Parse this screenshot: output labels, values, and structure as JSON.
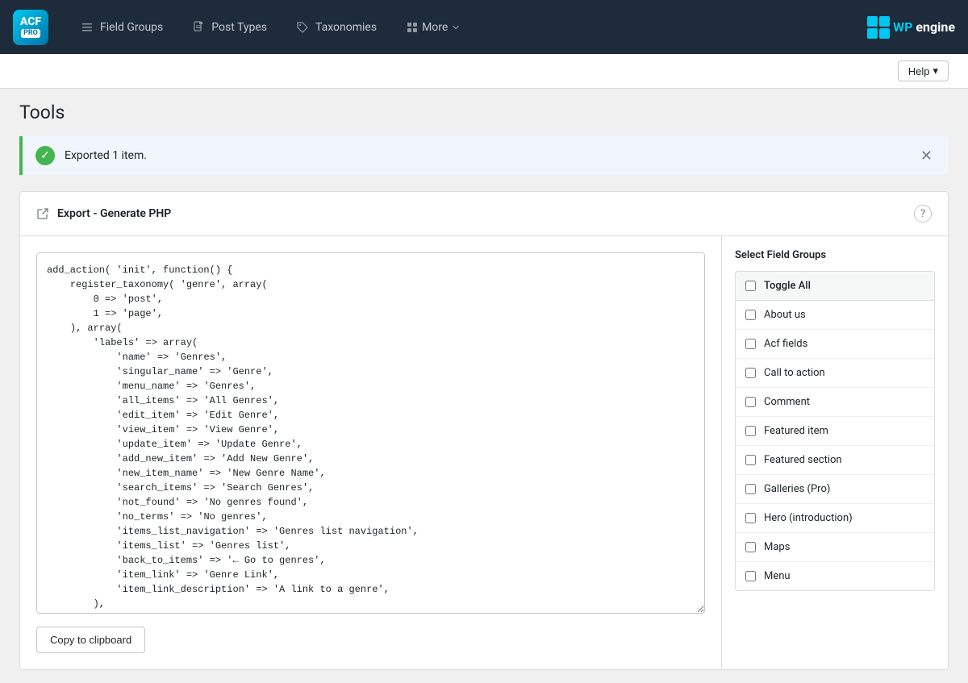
{
  "nav": {
    "logo_acf": "ACF",
    "logo_pro": "PRO",
    "items": [
      {
        "id": "field-groups",
        "label": "Field Groups",
        "icon": "list-icon"
      },
      {
        "id": "post-types",
        "label": "Post Types",
        "icon": "document-icon"
      },
      {
        "id": "taxonomies",
        "label": "Taxonomies",
        "icon": "tag-icon"
      },
      {
        "id": "more",
        "label": "More",
        "icon": "grid-icon",
        "has_dropdown": true
      }
    ],
    "wp_engine_label": "WP engine"
  },
  "page": {
    "title": "Tools"
  },
  "help": {
    "label": "Help",
    "dropdown_icon": "▾"
  },
  "notice": {
    "text": "Exported 1 item.",
    "type": "success"
  },
  "export": {
    "title": "Export - Generate PHP",
    "title_icon": "external-link-icon",
    "help_icon": "?"
  },
  "code": {
    "content": "add_action( 'init', function() {\n    register_taxonomy( 'genre', array(\n        0 => 'post',\n        1 => 'page',\n    ), array(\n        'labels' => array(\n            'name' => 'Genres',\n            'singular_name' => 'Genre',\n            'menu_name' => 'Genres',\n            'all_items' => 'All Genres',\n            'edit_item' => 'Edit Genre',\n            'view_item' => 'View Genre',\n            'update_item' => 'Update Genre',\n            'add_new_item' => 'Add New Genre',\n            'new_item_name' => 'New Genre Name',\n            'search_items' => 'Search Genres',\n            'not_found' => 'No genres found',\n            'no_terms' => 'No genres',\n            'items_list_navigation' => 'Genres list navigation',\n            'items_list' => 'Genres list',\n            'back_to_items' => '← Go to genres',\n            'item_link' => 'Genre Link',\n            'item_link_description' => 'A link to a genre',\n        ),\n        'public' => true,\n        'hierarchical' => true,\n        'show_in_menu' => true,"
  },
  "copy_button": {
    "label": "Copy to clipboard"
  },
  "sidebar": {
    "title": "Select Field Groups",
    "items": [
      {
        "id": "toggle-all",
        "label": "Toggle All",
        "is_toggle": true
      },
      {
        "id": "about-us",
        "label": "About us"
      },
      {
        "id": "acf-fields",
        "label": "Acf fields"
      },
      {
        "id": "call-to-action",
        "label": "Call to action"
      },
      {
        "id": "comment",
        "label": "Comment"
      },
      {
        "id": "featured-item",
        "label": "Featured item"
      },
      {
        "id": "featured-section",
        "label": "Featured section"
      },
      {
        "id": "galleries-pro",
        "label": "Galleries (Pro)"
      },
      {
        "id": "hero-introduction",
        "label": "Hero (introduction)"
      },
      {
        "id": "maps",
        "label": "Maps"
      },
      {
        "id": "menu",
        "label": "Menu"
      }
    ]
  }
}
